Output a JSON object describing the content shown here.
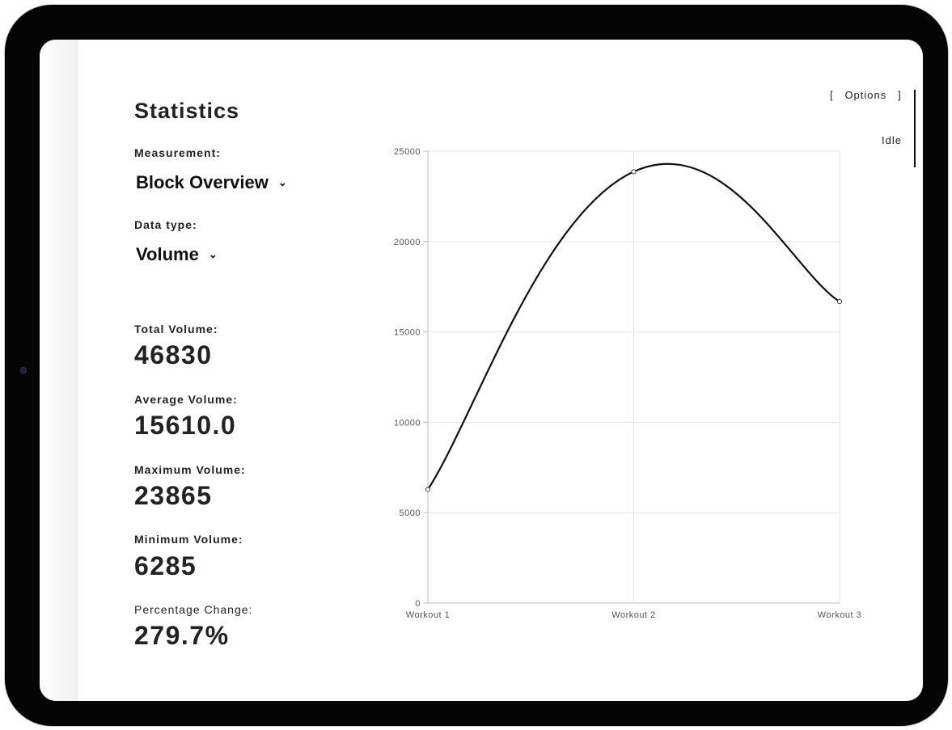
{
  "app": {
    "title": "Statistics",
    "measurement_label": "Measurement:",
    "measurement_value": "Block Overview",
    "data_type_label": "Data type:",
    "data_type_value": "Volume",
    "options_label": "[   Options   ]",
    "status_text": "Idle"
  },
  "stats": [
    {
      "label": "Total Volume:",
      "value": "46830"
    },
    {
      "label": "Average Volume:",
      "value": "15610.0"
    },
    {
      "label": "Maximum Volume:",
      "value": "23865"
    },
    {
      "label": "Minimum Volume:",
      "value": "6285"
    },
    {
      "label": "Percentage Change:",
      "value": "279.7%"
    }
  ],
  "icons": {
    "dropdown": "chevron-down-icon"
  },
  "colors": {
    "line": "#111111",
    "grid": "#e5e5e5",
    "frame": "#050505"
  },
  "chart_data": {
    "type": "line",
    "categories": [
      "Workout 1",
      "Workout 2",
      "Workout 3"
    ],
    "values": [
      6285,
      23865,
      16680
    ],
    "ylim": [
      0,
      25000
    ],
    "yticks": [
      0,
      5000,
      10000,
      15000,
      20000,
      25000
    ],
    "grid": true,
    "smooth": true,
    "legend": "none"
  }
}
